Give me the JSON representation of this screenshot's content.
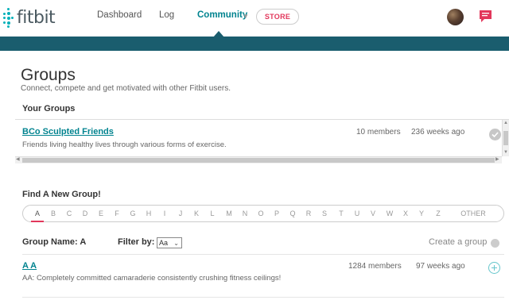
{
  "app": {
    "logo": "fitbit"
  },
  "nav": {
    "items": [
      {
        "label": "Dashboard"
      },
      {
        "label": "Log"
      },
      {
        "label": "Community"
      }
    ],
    "store_label": "STORE"
  },
  "colors": {
    "accent": "#00838f",
    "brand": "#00b0b9",
    "band": "#1a5d6e",
    "store": "#e2375b"
  },
  "page": {
    "title": "Groups",
    "subtitle": "Connect, compete and get motivated with other Fitbit users."
  },
  "your_groups": {
    "heading": "Your Groups",
    "items": [
      {
        "name": "BCo Sculpted Friends",
        "description": "Friends living healthy lives through various forms of exercise.",
        "members": "10 members",
        "age": "236 weeks ago"
      }
    ]
  },
  "find": {
    "heading": "Find A New Group!",
    "letters": [
      "A",
      "B",
      "C",
      "D",
      "E",
      "F",
      "G",
      "H",
      "I",
      "J",
      "K",
      "L",
      "M",
      "N",
      "O",
      "P",
      "Q",
      "R",
      "S",
      "T",
      "U",
      "V",
      "W",
      "X",
      "Y",
      "Z",
      "OTHER"
    ],
    "active_letter": "A"
  },
  "results": {
    "group_name_label": "Group Name: A",
    "filter_label": "Filter by:",
    "filter_value": "Aa",
    "create_label": "Create a group",
    "items": [
      {
        "name": "A A",
        "description": "AA: Completely committed camaraderie consistently crushing fitness ceilings!",
        "members": "1284 members",
        "age": "97 weeks ago"
      }
    ]
  }
}
